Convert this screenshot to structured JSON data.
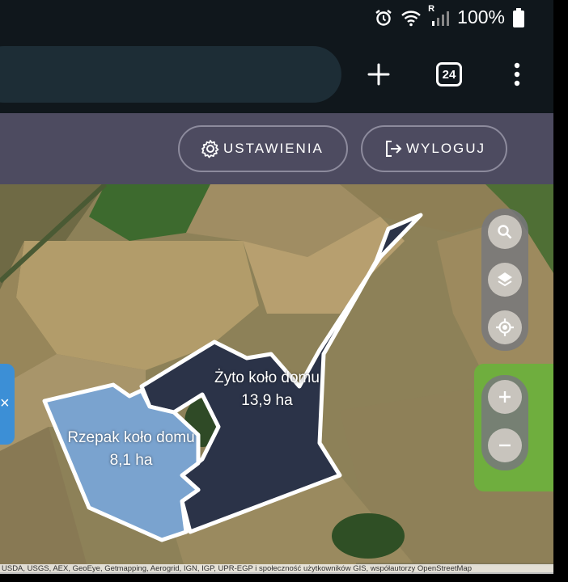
{
  "status_bar": {
    "battery_text": "100%",
    "icons": [
      "alarm-icon",
      "wifi-icon",
      "signal-icon",
      "battery-icon"
    ],
    "signal_badge": "R"
  },
  "browser": {
    "tab_count": "24",
    "icons": [
      "add-tab-icon",
      "tabs-icon",
      "more-vert-icon"
    ]
  },
  "header": {
    "settings_label": "USTAWIENIA",
    "logout_label": "WYLOGUJ"
  },
  "map": {
    "fields": [
      {
        "name": "Żyto koło domu",
        "area": "13,9 ha",
        "color": "#2b3348"
      },
      {
        "name": "Rzepak koło domu",
        "area": "8,1 ha",
        "color": "#7aa3cf"
      }
    ],
    "controls": [
      "search-icon",
      "layers-icon",
      "locate-icon",
      "zoom-in-icon",
      "zoom-out-icon"
    ],
    "attribution": "USDA, USGS, AEX, GeoEye, Getmapping, Aerogrid, IGN, IGP, UPR-EGP i społeczność użytkowników GIS, współautorzy OpenStreetMap"
  },
  "colors": {
    "header_bg": "#4d4b60",
    "browser_bg": "#10171c",
    "accent_green": "#6fae3e",
    "accent_blue": "#3c8fd6"
  }
}
